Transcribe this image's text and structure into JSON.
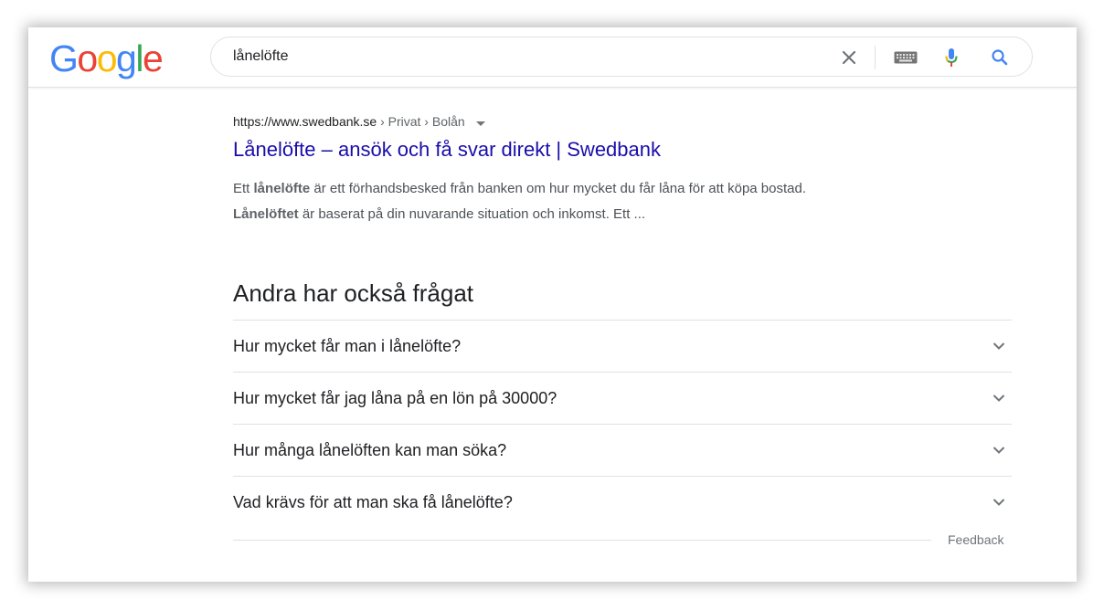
{
  "logo": {
    "letters": [
      "G",
      "o",
      "o",
      "g",
      "l",
      "e"
    ],
    "colors": [
      "#4285F4",
      "#EA4335",
      "#FBBC05",
      "#4285F4",
      "#34A853",
      "#EA4335"
    ]
  },
  "search": {
    "query": "lånelöfte",
    "icons": [
      "clear-icon",
      "keyboard-icon",
      "microphone-icon",
      "search-icon"
    ]
  },
  "result": {
    "url_domain": "https://www.swedbank.se",
    "url_path": " › Privat › Bolån",
    "title": "Lånelöfte – ansök och få svar direkt | Swedbank",
    "snippet_1a": "Ett ",
    "snippet_1b": "lånelöfte",
    "snippet_1c": " är ett förhandsbesked från banken om hur mycket du får låna för att köpa bostad.",
    "snippet_2a": "Lånelöftet",
    "snippet_2b": " är baserat på din nuvarande situation och inkomst. Ett ..."
  },
  "paa": {
    "heading": "Andra har också frågat",
    "questions": [
      "Hur mycket får man i lånelöfte?",
      "Hur mycket får jag låna på en lön på 30000?",
      "Hur många lånelöften kan man söka?",
      "Vad krävs för att man ska få lånelöfte?"
    ],
    "feedback": "Feedback"
  },
  "colors": {
    "link": "#1a0dab",
    "text": "#202124",
    "muted": "#4d5156",
    "divider": "#dfe1e5"
  }
}
